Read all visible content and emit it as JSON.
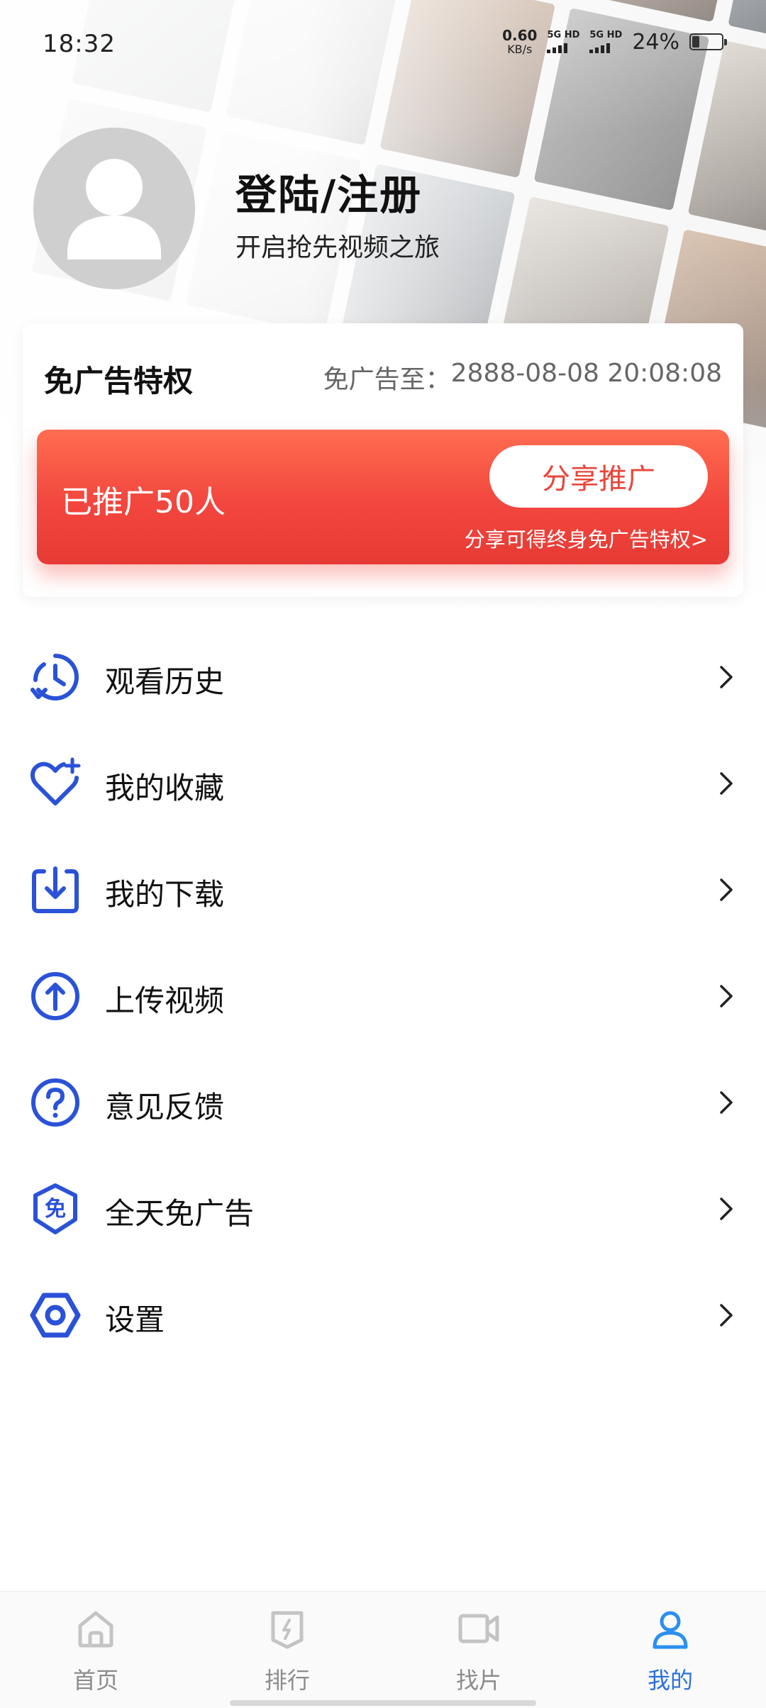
{
  "status_bar": {
    "time": "18:32",
    "net_speed_value": "0.60",
    "net_speed_unit": "KB/s",
    "sim1_label": "5G HD",
    "sim2_label": "5G HD",
    "battery_percent": "24%",
    "battery_level": 0.24
  },
  "profile": {
    "title": "登陆/注册",
    "subtitle": "开启抢先视频之旅"
  },
  "privilege_card": {
    "title": "免广告特权",
    "expiry_label": "免广告至：",
    "expiry_value": "2888-08-08 20:08:08",
    "promo": {
      "count_text": "已推广50人",
      "share_button": "分享推广",
      "link_text": "分享可得终身免广告特权>"
    }
  },
  "menu": {
    "items": [
      {
        "label": "观看历史",
        "icon": "history-icon"
      },
      {
        "label": "我的收藏",
        "icon": "favorite-heart-icon"
      },
      {
        "label": "我的下载",
        "icon": "download-icon"
      },
      {
        "label": "上传视频",
        "icon": "upload-icon"
      },
      {
        "label": "意见反馈",
        "icon": "feedback-question-icon"
      },
      {
        "label": "全天免广告",
        "icon": "ad-free-icon",
        "icon_glyph": "免"
      },
      {
        "label": "设置",
        "icon": "settings-hex-icon"
      }
    ]
  },
  "bottom_nav": {
    "items": [
      {
        "label": "首页",
        "icon": "home-icon",
        "active": false
      },
      {
        "label": "排行",
        "icon": "ranking-icon",
        "active": false
      },
      {
        "label": "找片",
        "icon": "find-video-icon",
        "active": false
      },
      {
        "label": "我的",
        "icon": "profile-icon",
        "active": true
      }
    ]
  },
  "colors": {
    "accent_blue": "#2b6fe0",
    "icon_blue": "#2a52d8",
    "promo_red": "#f2463e",
    "inactive_gray": "#8c8c8c"
  }
}
